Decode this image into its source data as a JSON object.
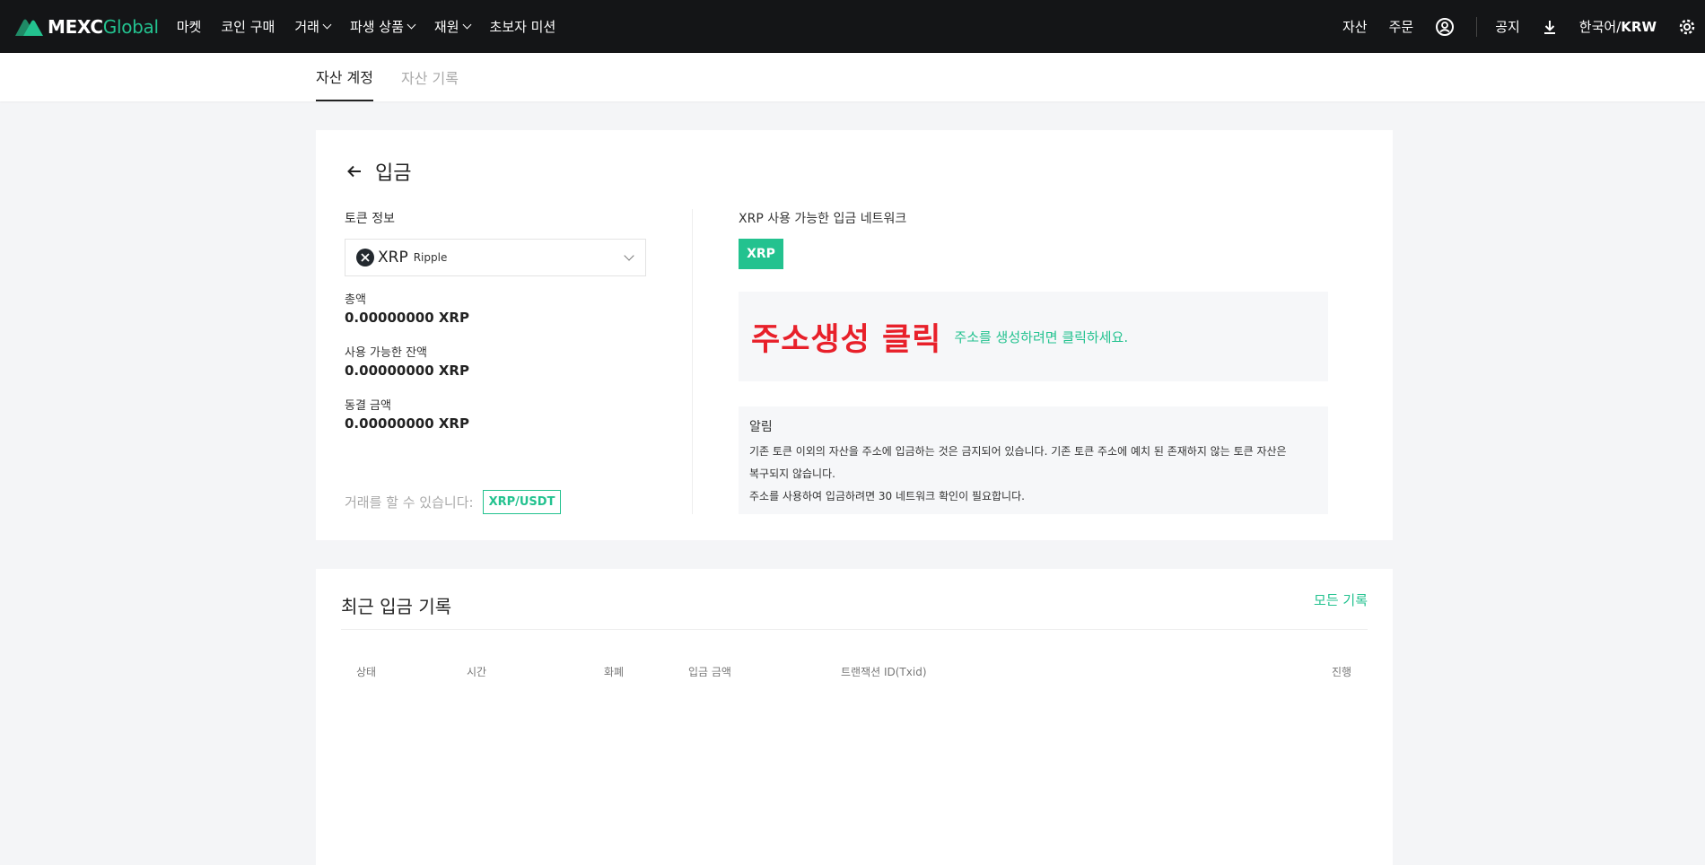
{
  "brand": {
    "name_bold": "MEXC",
    "name_light": "Global",
    "color_accent": "#23c28f"
  },
  "nav": {
    "items": [
      {
        "label": "마켓",
        "dropdown": false
      },
      {
        "label": "코인 구매",
        "dropdown": false
      },
      {
        "label": "거래",
        "dropdown": true
      },
      {
        "label": "파생 상품",
        "dropdown": true
      },
      {
        "label": "재원",
        "dropdown": true
      },
      {
        "label": "초보자 미션",
        "dropdown": false
      }
    ],
    "right": {
      "assets": "자산",
      "orders": "주문",
      "notice": "공지",
      "lang_prefix": "한국어/",
      "currency": "KRW"
    }
  },
  "subtabs": {
    "account": "자산 계정",
    "history": "자산 기록"
  },
  "deposit": {
    "title": "입금",
    "token_info_label": "토큰 정보",
    "token": {
      "symbol": "XRP",
      "name": "Ripple",
      "icon": "xrp-coin-icon"
    },
    "total_label": "총액",
    "total_value": "0.00000000 XRP",
    "available_label": "사용 가능한 잔액",
    "available_value": "0.00000000 XRP",
    "frozen_label": "동결 금액",
    "frozen_value": "0.00000000 XRP",
    "trade_label": "거래를 할 수 있습니다:",
    "trade_pair": "XRP/USDT",
    "network_label": "XRP 사용 가능한 입금 네트워크",
    "network_button": "XRP",
    "generate_big": "주소생성 클릭",
    "generate_hint": "주소를 생성하려면 클릭하세요.",
    "notice_title": "알림",
    "notice_lines": [
      "기존 토큰 이외의 자산을 주소에 입금하는 것은 금지되어 있습니다. 기존 토큰 주소에 예치 된 존재하지 않는 토큰 자산은",
      "복구되지 않습니다.",
      "주소를 사용하여 입금하려면 30 네트워크 확인이 필요합니다."
    ],
    "highlight_color": "#e8202a"
  },
  "records": {
    "title": "최근 입금 기록",
    "view_all": "모든 기록",
    "columns": [
      "상태",
      "시간",
      "화폐",
      "입금 금액",
      "트랜잭션 ID(Txid)",
      "진행"
    ]
  }
}
